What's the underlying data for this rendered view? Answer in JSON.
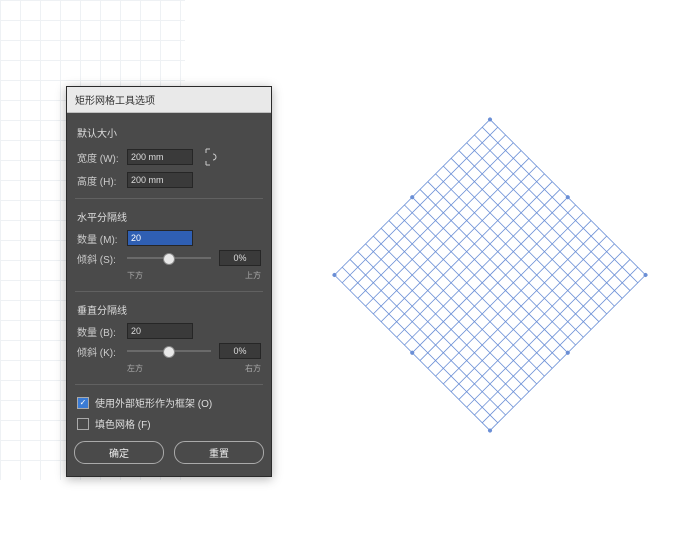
{
  "dialog": {
    "title": "矩形网格工具选项",
    "size": {
      "heading": "默认大小",
      "width_label": "宽度 (W):",
      "width_value": "200 mm",
      "height_label": "高度 (H):",
      "height_value": "200 mm"
    },
    "horizontal": {
      "heading": "水平分隔线",
      "count_label": "数量 (M):",
      "count_value": "20",
      "skew_label": "倾斜 (S):",
      "skew_value": "0%",
      "left_label": "下方",
      "right_label": "上方",
      "skew_fraction": 0.5
    },
    "vertical": {
      "heading": "垂直分隔线",
      "count_label": "数量 (B):",
      "count_value": "20",
      "skew_label": "倾斜 (K):",
      "skew_value": "0%",
      "left_label": "左方",
      "right_label": "右方",
      "skew_fraction": 0.5
    },
    "options": {
      "use_frame_label": "使用外部矩形作为框架 (O)",
      "use_frame_checked": true,
      "fill_grid_label": "填色网格 (F)",
      "fill_grid_checked": false
    },
    "buttons": {
      "ok": "确定",
      "reset": "重置"
    },
    "colors": {
      "panel": "#4a4a4a",
      "accent": "#2f5fb3",
      "grid": "#6b8fd6"
    }
  },
  "preview": {
    "grid_divisions": 20,
    "rotation_deg": 45,
    "stroke": "#6b8fd6"
  }
}
